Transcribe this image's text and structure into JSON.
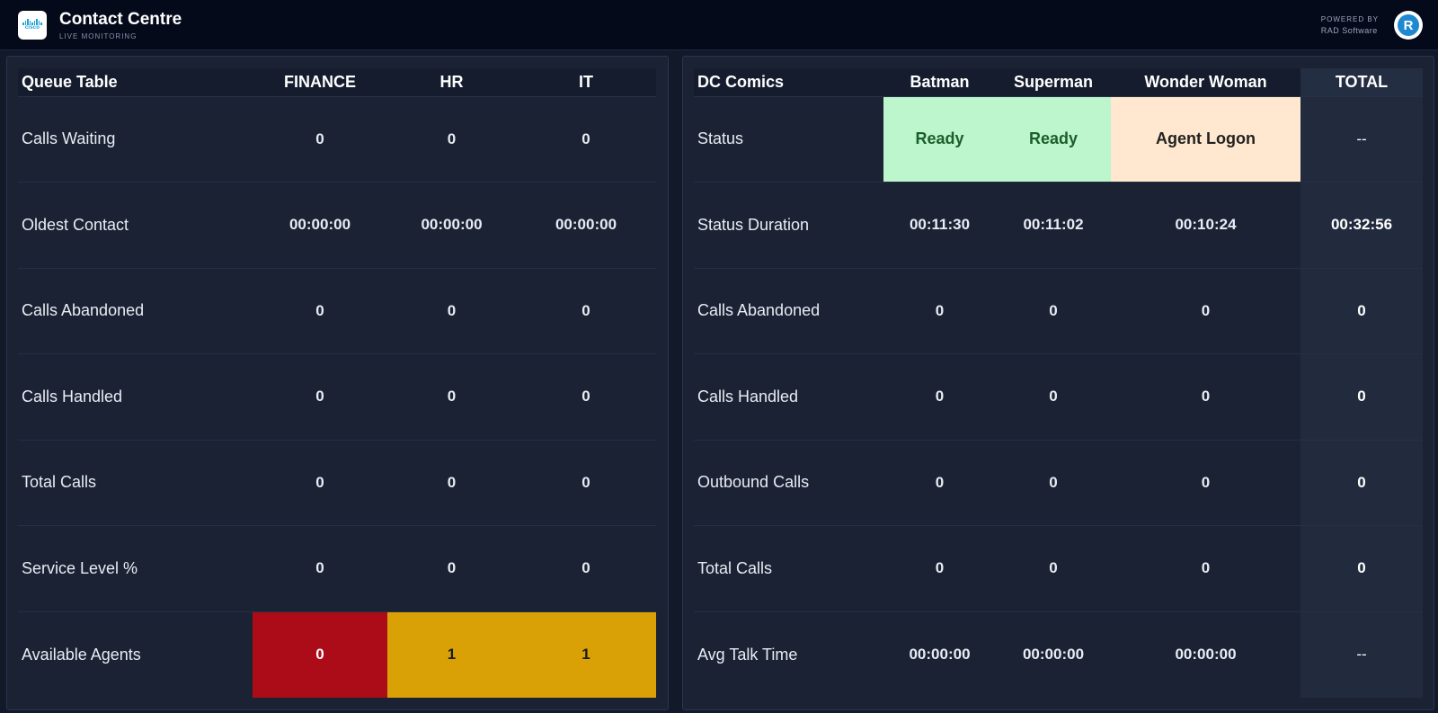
{
  "header": {
    "title": "Contact Centre",
    "subtitle": "LIVE MONITORING",
    "powered_line1": "POWERED BY",
    "powered_line2": "RAD Software",
    "cisco_text": "cisco",
    "rad_letter": "R"
  },
  "queue_table": {
    "columns": [
      "Queue Table",
      "FINANCE",
      "HR",
      "IT"
    ],
    "rows": [
      {
        "label": "Calls Waiting",
        "values": [
          "0",
          "0",
          "0"
        ]
      },
      {
        "label": "Oldest Contact",
        "values": [
          "00:00:00",
          "00:00:00",
          "00:00:00"
        ]
      },
      {
        "label": "Calls Abandoned",
        "values": [
          "0",
          "0",
          "0"
        ]
      },
      {
        "label": "Calls Handled",
        "values": [
          "0",
          "0",
          "0"
        ]
      },
      {
        "label": "Total Calls",
        "values": [
          "0",
          "0",
          "0"
        ]
      },
      {
        "label": "Service Level %",
        "values": [
          "0",
          "0",
          "0"
        ]
      },
      {
        "label": "Available Agents",
        "values": [
          "0",
          "1",
          "1"
        ]
      }
    ]
  },
  "agent_table": {
    "columns": [
      "DC Comics",
      "Batman",
      "Superman",
      "Wonder Woman",
      "TOTAL"
    ],
    "rows": [
      {
        "label": "Status",
        "values": [
          "Ready",
          "Ready",
          "Agent Logon",
          "--"
        ]
      },
      {
        "label": "Status Duration",
        "values": [
          "00:11:30",
          "00:11:02",
          "00:10:24",
          "00:32:56"
        ]
      },
      {
        "label": "Calls Abandoned",
        "values": [
          "0",
          "0",
          "0",
          "0"
        ]
      },
      {
        "label": "Calls Handled",
        "values": [
          "0",
          "0",
          "0",
          "0"
        ]
      },
      {
        "label": "Outbound Calls",
        "values": [
          "0",
          "0",
          "0",
          "0"
        ]
      },
      {
        "label": "Total Calls",
        "values": [
          "0",
          "0",
          "0",
          "0"
        ]
      },
      {
        "label": "Avg Talk Time",
        "values": [
          "00:00:00",
          "00:00:00",
          "00:00:00",
          "--"
        ]
      }
    ]
  },
  "colors": {
    "alert_red": "#ab0c17",
    "warning_amber": "#d9a106",
    "ready_green": "#bdf5cd",
    "logon_peach": "#ffe8cf"
  }
}
